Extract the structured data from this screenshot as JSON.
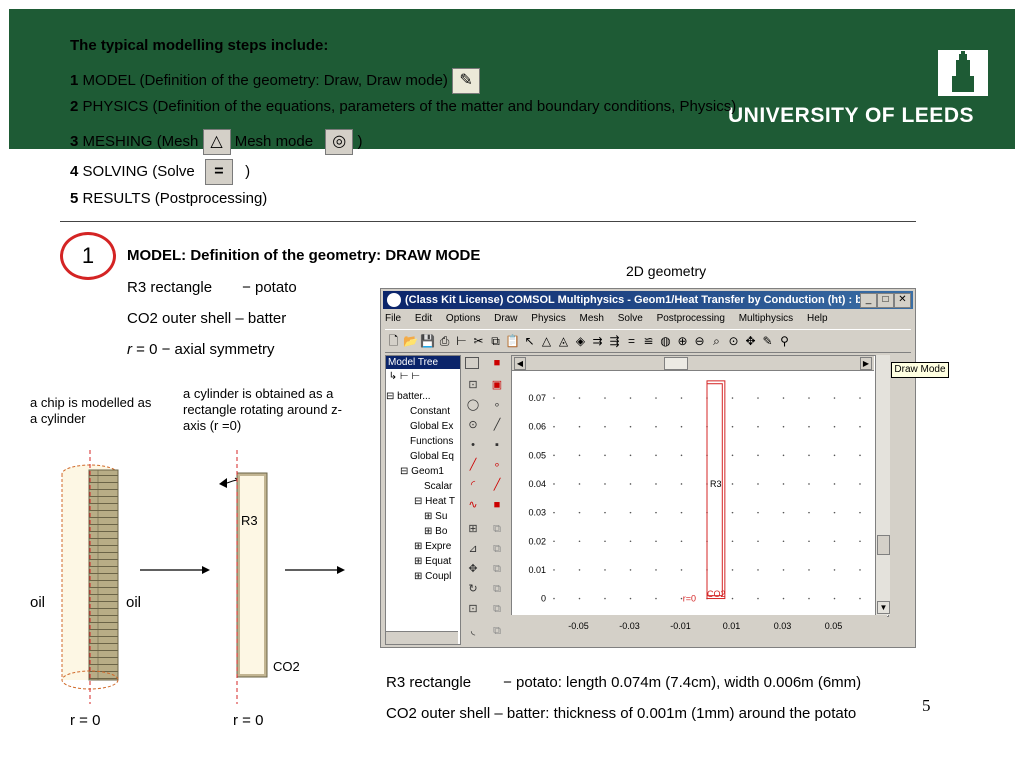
{
  "banner": {
    "university": "UNIVERSITY OF LEEDS"
  },
  "steps": {
    "heading": "The typical modelling steps include:",
    "s1_num": "1",
    "s1_text": "MODEL (Definition of the geometry: Draw, Draw mode)",
    "s2_num": "2",
    "s2_text": "PHYSICS (Definition of the equations, parameters of the matter and boundary conditions, Physics)",
    "s3_num": "3",
    "s3_text_a": "MESHING (Mesh",
    "s3_text_b": "Mesh mode",
    "s3_text_c": ")",
    "s4_num": "4",
    "s4_text_a": "SOLVING (Solve",
    "s4_text_b": ")",
    "s5_num": "5",
    "s5_text": "RESULTS (Postprocessing)"
  },
  "section": {
    "number": "1",
    "title": "MODEL: Definition of the geometry: DRAW MODE",
    "line1_a": "R3 rectangle",
    "line1_b": "− potato",
    "line2": "CO2 outer shell – batter",
    "line3_r": "r",
    "line3_rest": " = 0 − axial symmetry",
    "geom_label": "2D geometry"
  },
  "diagram": {
    "chip_note": "a chip is modelled as a cylinder",
    "cyl_note": "a cylinder is obtained as a rectangle rotating around z-axis (r =0)",
    "oil_left": "oil",
    "oil_right": "oil",
    "r3": "R3",
    "co2": "CO2",
    "r0_left": "r = 0",
    "r0_right": "r = 0"
  },
  "app": {
    "title": "(Class Kit License) COMSOL Multiphysics - Geom1/Heat Transfer by Conduction (ht) : b...",
    "menus": [
      "File",
      "Edit",
      "Options",
      "Draw",
      "Physics",
      "Mesh",
      "Solve",
      "Postprocessing",
      "Multiphysics",
      "Help"
    ],
    "tree_title": "Model Tree",
    "tree_items": [
      "batter...",
      "Constant",
      "Global Ex",
      "Functions",
      "Global Eq",
      "Geom1",
      "Scalar",
      "Heat T",
      "Su",
      "Bo",
      "Expre",
      "Equat",
      "Coupl"
    ],
    "tooltip": "Draw Mode",
    "r3_label": "R3",
    "r0_label": "r=0",
    "co2_label": "CO2"
  },
  "chart_data": {
    "type": "scatter",
    "x_ticks": [
      "-0.05",
      "-0.03",
      "-0.01",
      "0.01",
      "0.03",
      "0.05"
    ],
    "y_ticks": [
      "0.07",
      "0.06",
      "0.05",
      "0.04",
      "0.03",
      "0.02",
      "0.01",
      "0"
    ],
    "xlim": [
      -0.06,
      0.06
    ],
    "ylim": [
      -0.004,
      0.077
    ],
    "grid": true,
    "rectangles": [
      {
        "name": "R3",
        "x0": 0.0,
        "x1": 0.006,
        "y0": 0.001,
        "y1": 0.075
      },
      {
        "name": "CO2",
        "x0": 0.0,
        "x1": 0.007,
        "y0": 0.0,
        "y1": 0.076
      }
    ]
  },
  "bottom": {
    "line1_a": "R3 rectangle",
    "line1_b": "− potato: length 0.074m (7.4cm), width 0.006m (6mm)",
    "line2": "CO2 outer shell – batter: thickness of 0.001m (1mm) around the potato",
    "page_number": "5"
  }
}
